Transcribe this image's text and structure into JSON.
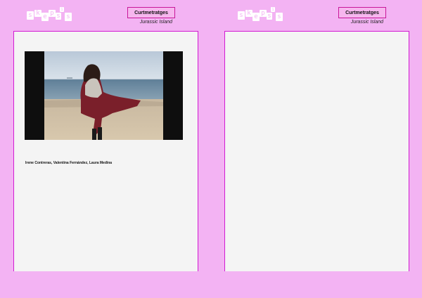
{
  "logo_letters": [
    "s",
    "k",
    "e",
    "p",
    "s",
    "i",
    "s"
  ],
  "pages": [
    {
      "tag": "Curtmetratges",
      "subtitle": "Jurassic Island",
      "credits": "Irene Contreras, Valentina Fernández, Laura Medina"
    },
    {
      "tag": "Curtmetratges",
      "subtitle": "Jurassic Island"
    }
  ],
  "colors": {
    "background": "#f3b3f3",
    "accent": "#d21bd2",
    "sheet": "#f4f4f4"
  }
}
